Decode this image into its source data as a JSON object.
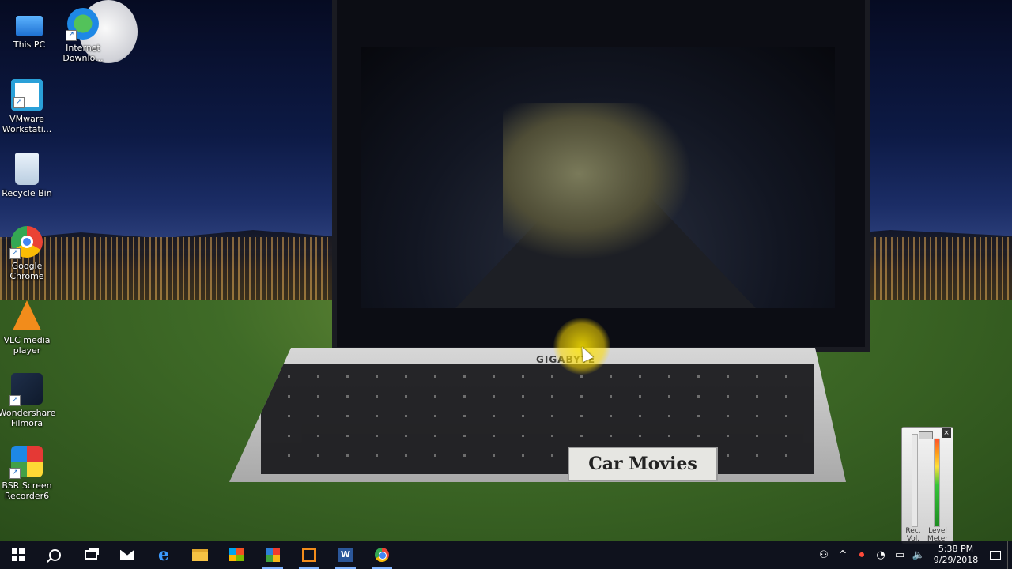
{
  "desktop": {
    "icons": [
      {
        "label": "This PC"
      },
      {
        "label": "Internet Downlo..."
      },
      {
        "label": "VMware Workstati..."
      },
      {
        "label": "Recycle Bin"
      },
      {
        "label": "Google Chrome"
      },
      {
        "label": "VLC media player"
      },
      {
        "label": "Wondershare Filmora"
      },
      {
        "label": "BSR Screen Recorder6"
      }
    ]
  },
  "wallpaper": {
    "brand_text": "GIGABYTE",
    "sign_text": "Car Movies"
  },
  "level_meter": {
    "close_label": "×",
    "rec_vol_label": "Rec. Vol.",
    "level_meter_label": "Level Meter",
    "level_fraction": 0.95,
    "rec_vol_fraction": 1.0
  },
  "taskbar": {
    "pinned": [
      {
        "name": "start"
      },
      {
        "name": "search"
      },
      {
        "name": "task-view"
      },
      {
        "name": "mail"
      },
      {
        "name": "edge"
      },
      {
        "name": "file-explorer"
      },
      {
        "name": "store"
      },
      {
        "name": "tiles-app",
        "running": true
      },
      {
        "name": "vmware",
        "running": true
      },
      {
        "name": "word",
        "glyph": "W",
        "running": true
      },
      {
        "name": "chrome",
        "running": true
      }
    ],
    "tray": {
      "people_glyph": "⚇",
      "chevron_glyph": "^",
      "record_glyph": "⏺",
      "network_glyph": "◔",
      "battery_glyph": "▭",
      "volume_glyph": "🔈",
      "time": "5:38 PM",
      "date": "9/29/2018"
    }
  },
  "colors": {
    "taskbar_bg": "#10121c",
    "running_indicator": "#7fb3ff",
    "cursor_highlight": "#ffe600"
  }
}
